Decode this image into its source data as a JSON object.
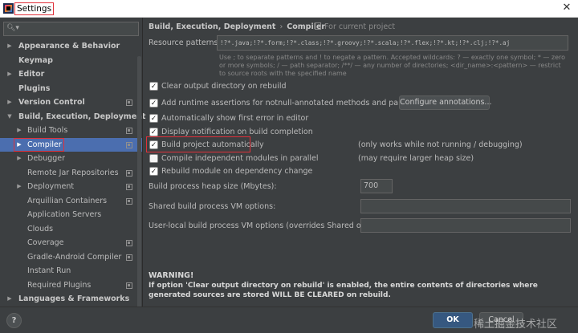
{
  "window": {
    "title": "Settings",
    "close_glyph": "✕"
  },
  "search": {
    "placeholder": "",
    "icon": "search-icon"
  },
  "sidebar": {
    "items": [
      {
        "label": "Appearance & Behavior",
        "arrow": "▶",
        "bold": true,
        "level": 0,
        "project_icon": false
      },
      {
        "label": "Keymap",
        "arrow": "",
        "bold": true,
        "level": 0,
        "project_icon": false
      },
      {
        "label": "Editor",
        "arrow": "▶",
        "bold": true,
        "level": 0,
        "project_icon": false
      },
      {
        "label": "Plugins",
        "arrow": "",
        "bold": true,
        "level": 0,
        "project_icon": false
      },
      {
        "label": "Version Control",
        "arrow": "▶",
        "bold": true,
        "level": 0,
        "project_icon": true
      },
      {
        "label": "Build, Execution, Deployment",
        "arrow": "▼",
        "bold": true,
        "level": 0,
        "project_icon": false
      },
      {
        "label": "Build Tools",
        "arrow": "▶",
        "bold": false,
        "level": 1,
        "project_icon": true
      },
      {
        "label": "Compiler",
        "arrow": "▶",
        "bold": false,
        "level": 1,
        "project_icon": true,
        "selected": true
      },
      {
        "label": "Debugger",
        "arrow": "▶",
        "bold": false,
        "level": 1,
        "project_icon": false
      },
      {
        "label": "Remote Jar Repositories",
        "arrow": "",
        "bold": false,
        "level": 1,
        "project_icon": true
      },
      {
        "label": "Deployment",
        "arrow": "▶",
        "bold": false,
        "level": 1,
        "project_icon": true
      },
      {
        "label": "Arquillian Containers",
        "arrow": "",
        "bold": false,
        "level": 1,
        "project_icon": true
      },
      {
        "label": "Application Servers",
        "arrow": "",
        "bold": false,
        "level": 1,
        "project_icon": false
      },
      {
        "label": "Clouds",
        "arrow": "",
        "bold": false,
        "level": 1,
        "project_icon": false
      },
      {
        "label": "Coverage",
        "arrow": "",
        "bold": false,
        "level": 1,
        "project_icon": true
      },
      {
        "label": "Gradle-Android Compiler",
        "arrow": "",
        "bold": false,
        "level": 1,
        "project_icon": true
      },
      {
        "label": "Instant Run",
        "arrow": "",
        "bold": false,
        "level": 1,
        "project_icon": false
      },
      {
        "label": "Required Plugins",
        "arrow": "",
        "bold": false,
        "level": 1,
        "project_icon": true
      },
      {
        "label": "Languages & Frameworks",
        "arrow": "▶",
        "bold": true,
        "level": 0,
        "project_icon": false
      }
    ]
  },
  "breadcrumb": {
    "part1": "Build, Execution, Deployment",
    "sep": "›",
    "part2": "Compiler"
  },
  "scope_label": "For current project",
  "resource_patterns": {
    "label": "Resource patterns:",
    "value": "!?*.java;!?*.form;!?*.class;!?*.groovy;!?*.scala;!?*.flex;!?*.kt;!?*.clj;!?*.aj",
    "hint": "Use ; to separate patterns and ! to negate a pattern. Accepted wildcards: ? — exactly one symbol; * — zero or more symbols; / — path separator; /**/ — any number of directories; <dir_name>:<pattern> — restrict to source roots with the specified name"
  },
  "options": [
    {
      "label": "Clear output directory on rebuild",
      "checked": true
    },
    {
      "label": "Add runtime assertions for notnull-annotated methods and parameters",
      "checked": true
    },
    {
      "label": "Automatically show first error in editor",
      "checked": true
    },
    {
      "label": "Display notification on build completion",
      "checked": true
    },
    {
      "label": "Build project automatically",
      "checked": true
    },
    {
      "label": "Compile independent modules in parallel",
      "checked": false
    },
    {
      "label": "Rebuild module on dependency change",
      "checked": true
    }
  ],
  "configure_annotations_label": "Configure annotations...",
  "notes": {
    "build_auto": "(only works while not running / debugging)",
    "parallel": "(may require larger heap size)"
  },
  "heap": {
    "label": "Build process heap size (Mbytes):",
    "value": "700"
  },
  "shared_vm": {
    "label": "Shared build process VM options:",
    "value": ""
  },
  "user_vm": {
    "label": "User-local build process VM options (overrides Shared options):",
    "value": ""
  },
  "warning": {
    "title": "WARNING!",
    "text": "If option 'Clear output directory on rebuild' is enabled, the entire contents of directories where generated sources are stored WILL BE CLEARED on rebuild."
  },
  "footer": {
    "help": "?",
    "ok": "OK",
    "cancel": "Cancel",
    "watermark": "稀土掘金技术社区"
  },
  "colors": {
    "selection": "#4b6eaf",
    "highlight": "#e0303a",
    "ok_button": "#365880",
    "background": "#3c3f41"
  }
}
